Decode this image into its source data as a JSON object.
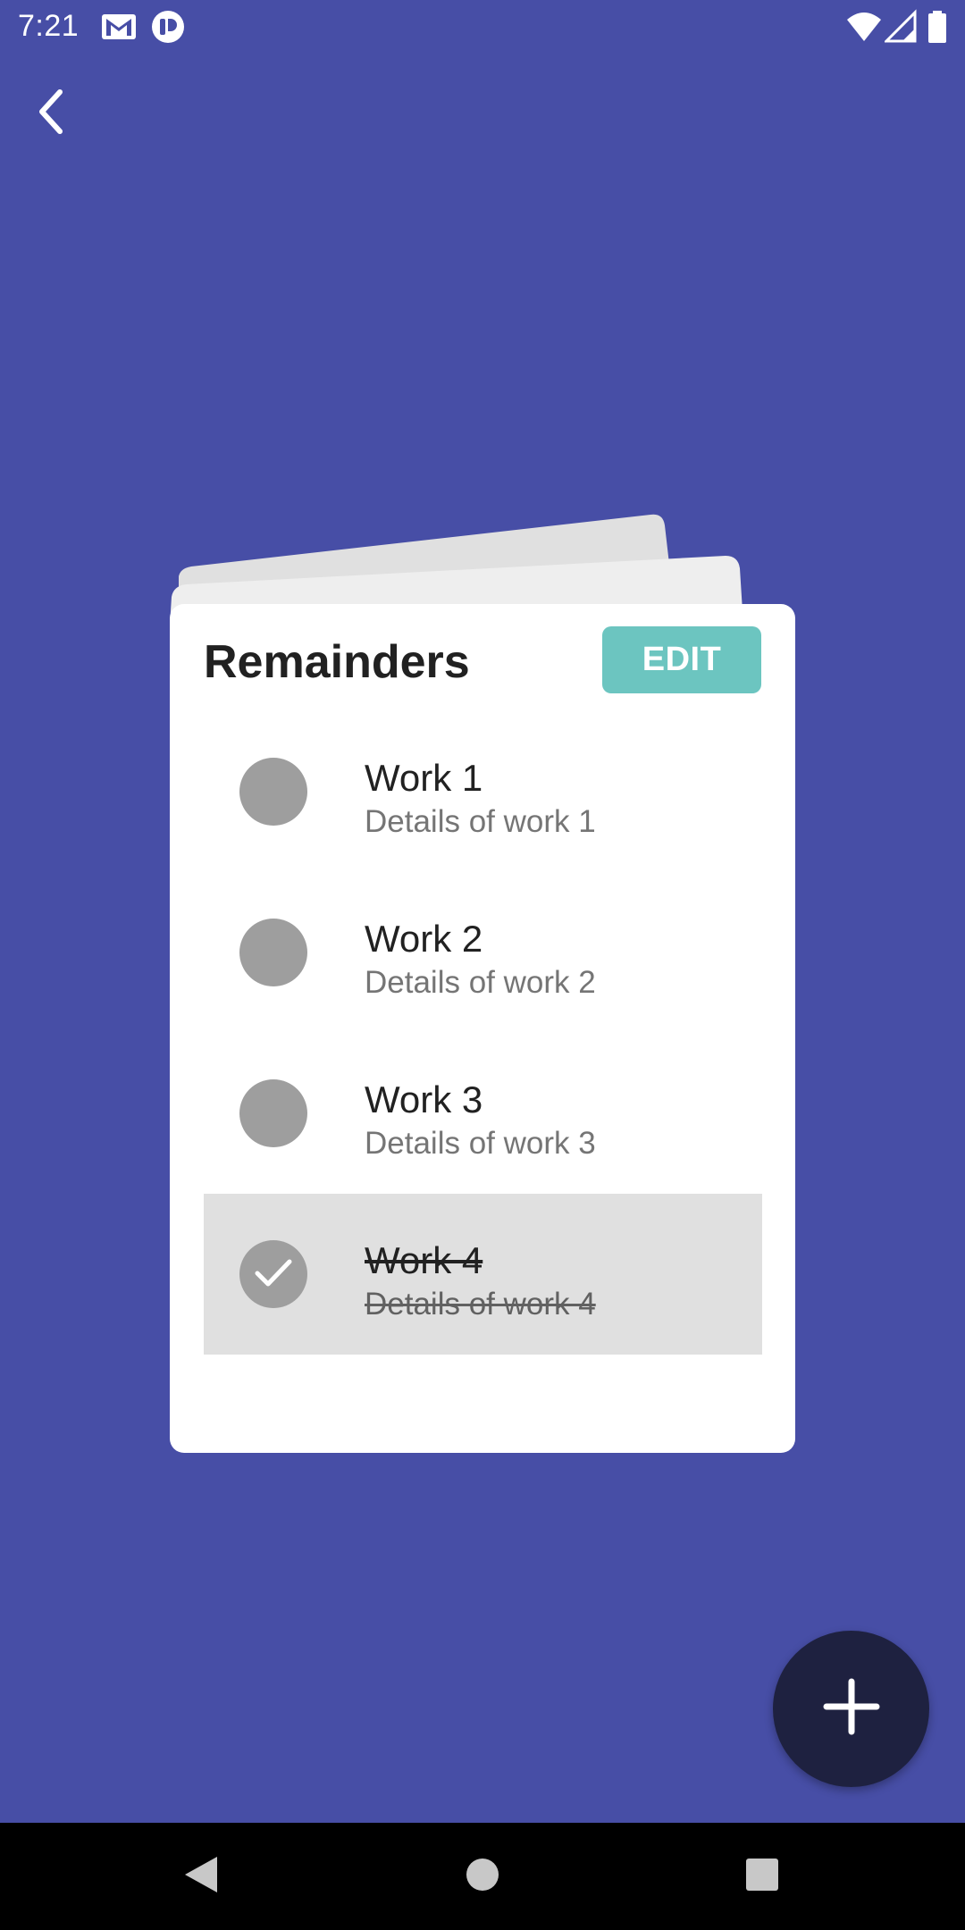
{
  "status_bar": {
    "time": "7:21",
    "icons": [
      "gmail-icon",
      "app-notification-icon",
      "wifi-icon",
      "signal-icon",
      "battery-icon"
    ]
  },
  "toolbar": {
    "back_icon": "chevron-left-icon"
  },
  "card": {
    "title": "Remainders",
    "edit_label": "EDIT"
  },
  "tasks": [
    {
      "title": "Work 1",
      "detail": "Details of work 1",
      "done": false
    },
    {
      "title": "Work 2",
      "detail": "Details of work 2",
      "done": false
    },
    {
      "title": "Work 3",
      "detail": "Details of work 3",
      "done": false
    },
    {
      "title": "Work 4",
      "detail": "Details of work 4",
      "done": true
    }
  ],
  "fab": {
    "icon": "plus-icon"
  },
  "nav_bar": {
    "icons": [
      "back-triangle-icon",
      "home-circle-icon",
      "recents-square-icon"
    ]
  },
  "colors": {
    "background": "#474ea6",
    "card": "#ffffff",
    "edit_button": "#6cc5c0",
    "fab": "#1e2140",
    "check_circle": "#9e9e9e",
    "done_row": "#e0e0e0"
  }
}
